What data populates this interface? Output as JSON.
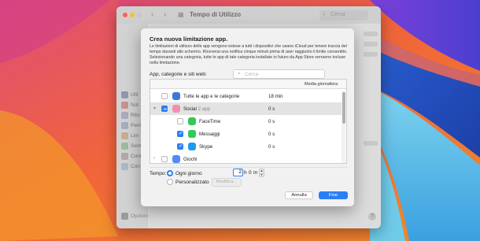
{
  "window": {
    "title": "Tempo di Utilizzo",
    "search_placeholder": "Cerca",
    "help": "?",
    "sidebar": {
      "items": [
        {
          "label": "Util",
          "color": "#8f97b3"
        },
        {
          "label": "Not",
          "color": "#c79191"
        },
        {
          "label": "Rito",
          "color": "#a9a9c0"
        },
        {
          "label": "Perm",
          "color": "#a3aebf"
        },
        {
          "label": "Lim",
          "color": "#c9ad8f"
        },
        {
          "label": "Sem",
          "color": "#9dbb9d"
        },
        {
          "label": "Cont",
          "color": "#b8a7a7"
        },
        {
          "label": "Con",
          "color": "#a8b8c5"
        }
      ],
      "options_label": "Opzioni"
    }
  },
  "sheet": {
    "title": "Crea nuova limitazione app.",
    "description": "Le limitazioni di utilizzo delle app vengono estese a tutti i dispositivi che usano iCloud per tenere traccia del tempo davanti allo schermo. Riceverai una notifica cinque minuti prima di aver raggiunto il limite consentito. Selezionando una categoria, tutte le app di tale categoria installate in futuro da App Store verranno incluse nella limitazione.",
    "apps_label": "App, categorie e siti web:",
    "search_placeholder": "Cerca",
    "column_header": "Media giornaliera",
    "rows": [
      {
        "label": "Tutte le app e le categorie",
        "sub": "",
        "time": "18 min",
        "check": "off",
        "icon": "stack-icon",
        "icon_color": "#3c78d8",
        "indent": 0,
        "disclosure": "",
        "selected": false
      },
      {
        "label": "Social",
        "sub": "2 app",
        "time": "0 s",
        "check": "mixed",
        "icon": "social-icon",
        "icon_color": "#f08fb2",
        "indent": 0,
        "disclosure": "▾",
        "selected": true
      },
      {
        "label": "FaceTime",
        "sub": "",
        "time": "0 s",
        "check": "off",
        "icon": "facetime-icon",
        "icon_color": "#34c759",
        "indent": 1,
        "disclosure": "",
        "selected": false
      },
      {
        "label": "Messaggi",
        "sub": "",
        "time": "0 s",
        "check": "on",
        "icon": "messages-icon",
        "icon_color": "#35c95a",
        "indent": 1,
        "disclosure": "",
        "selected": false
      },
      {
        "label": "Skype",
        "sub": "",
        "time": "0 s",
        "check": "on",
        "icon": "skype-icon",
        "icon_color": "#1d9bf0",
        "indent": 1,
        "disclosure": "",
        "selected": false
      },
      {
        "label": "Giochi",
        "sub": "",
        "time": "",
        "check": "off",
        "icon": "games-icon",
        "icon_color": "#4f8cf5",
        "indent": 0,
        "disclosure": "›",
        "selected": false
      }
    ],
    "tempo_label": "Tempo:",
    "options": {
      "every_day": "Ogni giorno",
      "custom": "Personalizzato",
      "selected": "every_day"
    },
    "hours_value": "2",
    "hours_unit": "h",
    "minutes_value": "0",
    "minutes_unit": "m",
    "modify_label": "Modifica...",
    "cancel_label": "Annulla",
    "done_label": "Fine"
  },
  "colors": {
    "accent": "#2b7ff5"
  }
}
